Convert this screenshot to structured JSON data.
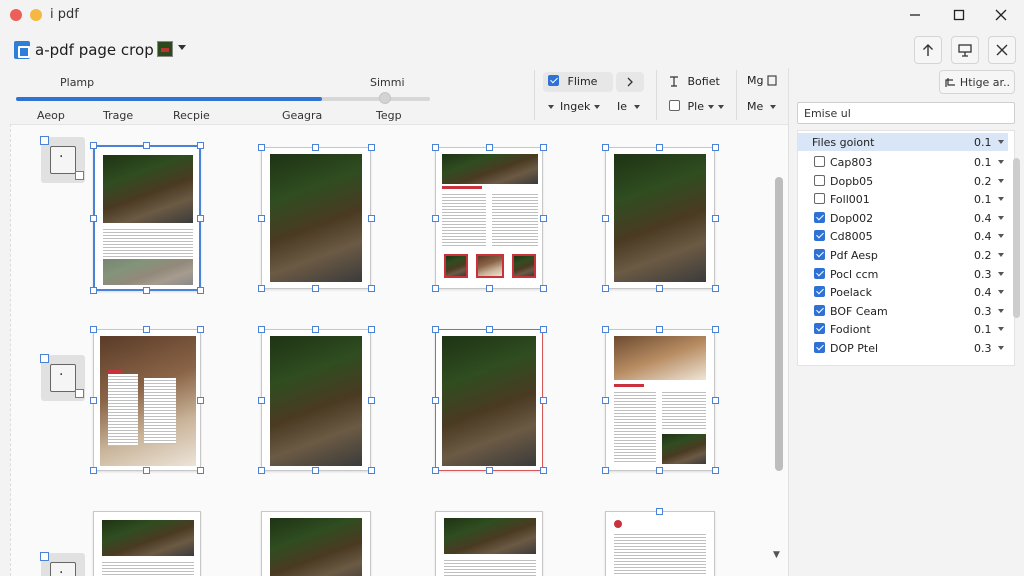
{
  "window": {
    "title": "i pdf",
    "traffic_colors": [
      "#ec5f5a",
      "#f4b942"
    ]
  },
  "header": {
    "doc_title": "a-pdf page crop"
  },
  "toolbar": {
    "slider_top_labels": [
      "Plamp",
      "Simmi"
    ],
    "slider_bottom_labels": [
      "Aeop",
      "Trage",
      "Recpie",
      "Geagra",
      "Tegp"
    ],
    "slider_progress_fraction": 0.74,
    "flame_label": "Flime",
    "ingek_label": "Ingek",
    "ie_label": "Ie",
    "bolot_label": "Bofiet",
    "ple_label": "Ple",
    "mg_label": "Mg",
    "me_label": "Me",
    "accent_color": "#2f72d6"
  },
  "panel": {
    "action_label": "Htige ar..",
    "search_value": "Emise ul",
    "list_header": {
      "label": "Files goiont",
      "value": "0.1"
    },
    "items": [
      {
        "label": "Cap803",
        "value": "0.1",
        "checked": false
      },
      {
        "label": "Dopb05",
        "value": "0.2",
        "checked": false
      },
      {
        "label": "Foll001",
        "value": "0.1",
        "checked": false
      },
      {
        "label": "Dop002",
        "value": "0.4",
        "checked": true
      },
      {
        "label": "Cd8005",
        "value": "0.4",
        "checked": true
      },
      {
        "label": "Pdf Aesp",
        "value": "0.2",
        "checked": true
      },
      {
        "label": "Pocl ccm",
        "value": "0.3",
        "checked": true
      },
      {
        "label": "Poelack",
        "value": "0.4",
        "checked": true
      },
      {
        "label": "BOF Ceam",
        "value": "0.3",
        "checked": true
      },
      {
        "label": "Fodiont",
        "value": "0.1",
        "checked": true
      },
      {
        "label": "DOP Ptel",
        "value": "0.3",
        "checked": true
      }
    ]
  }
}
